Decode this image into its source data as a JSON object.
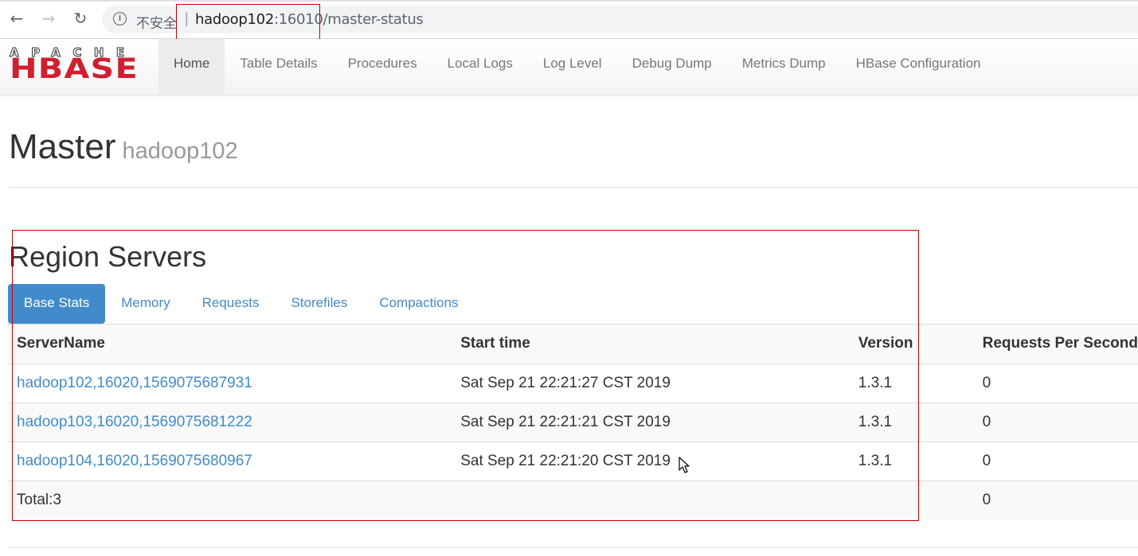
{
  "browser": {
    "back_icon": "←",
    "forward_icon": "→",
    "reload_icon": "↻",
    "info_icon": "i",
    "insecure_label": "不安全",
    "separator": "|",
    "url_host": "hadoop102",
    "url_rest": ":16010/master-status"
  },
  "logo": {
    "apache": "APACHE",
    "hbase": "HBASE"
  },
  "nav": {
    "items": [
      {
        "label": "Home"
      },
      {
        "label": "Table Details"
      },
      {
        "label": "Procedures"
      },
      {
        "label": "Local Logs"
      },
      {
        "label": "Log Level"
      },
      {
        "label": "Debug Dump"
      },
      {
        "label": "Metrics Dump"
      },
      {
        "label": "HBase Configuration"
      }
    ]
  },
  "page": {
    "title": "Master",
    "subtitle": "hadoop102"
  },
  "region_servers": {
    "title": "Region Servers",
    "tabs": [
      {
        "label": "Base Stats"
      },
      {
        "label": "Memory"
      },
      {
        "label": "Requests"
      },
      {
        "label": "Storefiles"
      },
      {
        "label": "Compactions"
      }
    ],
    "columns": [
      "ServerName",
      "Start time",
      "Version",
      "Requests Per Second"
    ],
    "rows": [
      {
        "server": "hadoop102,16020,1569075687931",
        "start": "Sat Sep 21 22:21:27 CST 2019",
        "version": "1.3.1",
        "rps": "0"
      },
      {
        "server": "hadoop103,16020,1569075681222",
        "start": "Sat Sep 21 22:21:21 CST 2019",
        "version": "1.3.1",
        "rps": "0"
      },
      {
        "server": "hadoop104,16020,1569075680967",
        "start": "Sat Sep 21 22:21:20 CST 2019",
        "version": "1.3.1",
        "rps": "0"
      }
    ],
    "total_label": "Total:3",
    "total_rps": "0"
  },
  "colors": {
    "accent": "#428bca",
    "brand_red": "#d01f2f",
    "annotation_red": "#c00000"
  }
}
